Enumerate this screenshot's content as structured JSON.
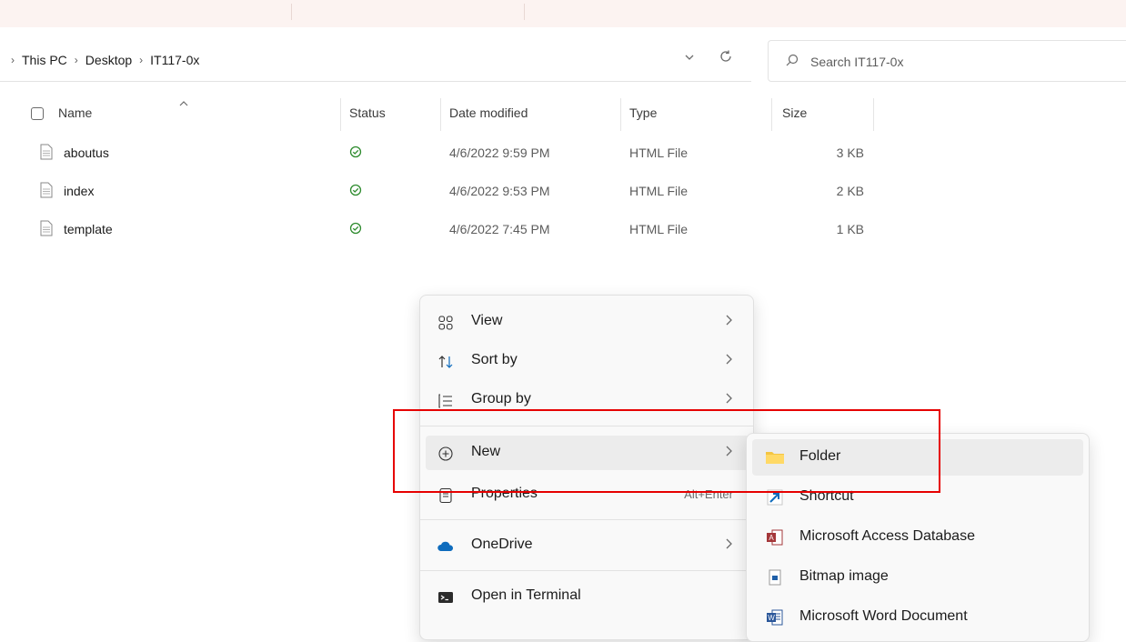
{
  "address": {
    "crumbs": [
      "This PC",
      "Desktop",
      "IT117-0x"
    ]
  },
  "search": {
    "placeholder": "Search IT117-0x"
  },
  "columns": {
    "name": "Name",
    "status": "Status",
    "date": "Date modified",
    "type": "Type",
    "size": "Size"
  },
  "files": [
    {
      "name": "aboutus",
      "date": "4/6/2022 9:59 PM",
      "type": "HTML File",
      "size": "3 KB"
    },
    {
      "name": "index",
      "date": "4/6/2022 9:53 PM",
      "type": "HTML File",
      "size": "2 KB"
    },
    {
      "name": "template",
      "date": "4/6/2022 7:45 PM",
      "type": "HTML File",
      "size": "1 KB"
    }
  ],
  "context_menu": {
    "view": "View",
    "sort_by": "Sort by",
    "group_by": "Group by",
    "new": "New",
    "properties": "Properties",
    "properties_shortcut": "Alt+Enter",
    "onedrive": "OneDrive",
    "open_terminal": "Open in Terminal"
  },
  "new_submenu": {
    "folder": "Folder",
    "shortcut": "Shortcut",
    "access": "Microsoft Access Database",
    "bitmap": "Bitmap image",
    "word": "Microsoft Word Document"
  },
  "colors": {
    "highlight": "#e60000",
    "sync_ok": "#2e8b2e",
    "onedrive": "#0f6cbd",
    "folder": "#f4c542"
  }
}
